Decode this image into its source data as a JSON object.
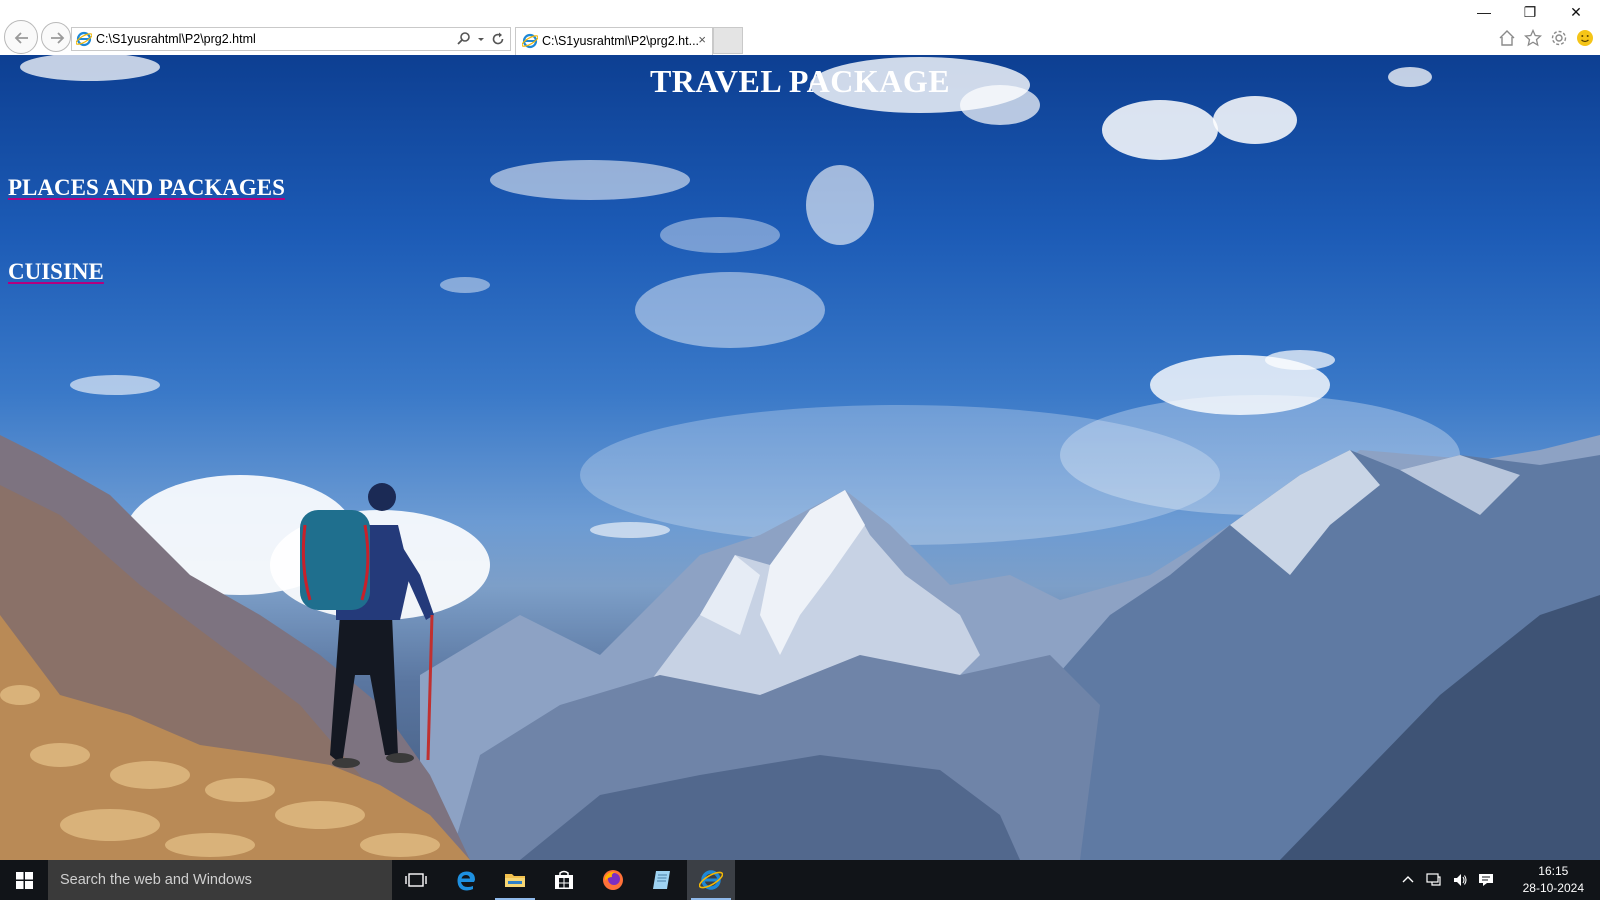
{
  "browser": {
    "url": "C:\\S1yusrahtml\\P2\\prg2.html",
    "tab_title": "C:\\S1yusrahtml\\P2\\prg2.ht...",
    "tab_close": "×",
    "window_controls": {
      "minimize": "—",
      "maximize": "❐",
      "close": "✕"
    }
  },
  "page": {
    "title": "TRAVEL PACKAGE",
    "links": [
      {
        "label": "PLACES AND PACKAGES"
      },
      {
        "label": "CUISINE"
      }
    ],
    "colors": {
      "text": "#ffffff",
      "link_underline": "#b30080",
      "sky_top": "#0d3f92"
    }
  },
  "taskbar": {
    "search_placeholder": "Search the web and Windows",
    "pinned_icons": [
      "task-view-icon",
      "edge-icon",
      "file-explorer-icon",
      "store-icon",
      "firefox-icon",
      "notepad-icon",
      "internet-explorer-icon"
    ],
    "clock": {
      "time": "16:15",
      "date": "28-10-2024"
    }
  }
}
